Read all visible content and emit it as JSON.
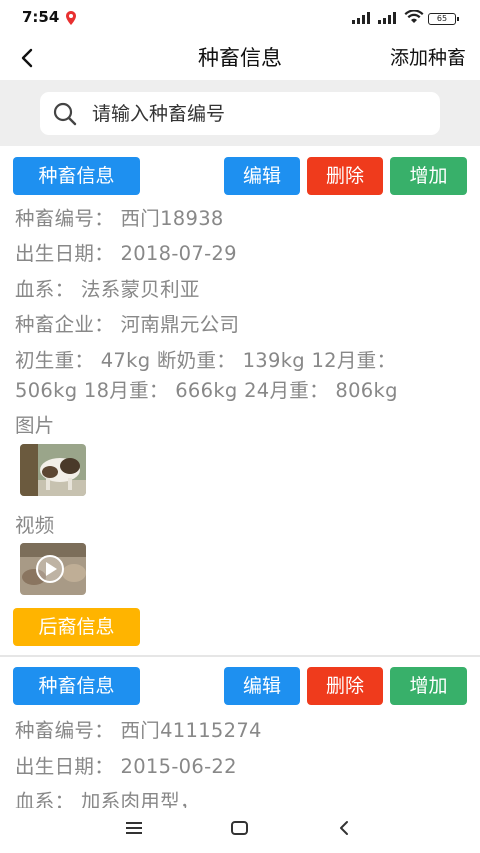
{
  "status": {
    "time": "7:54",
    "battery": "65"
  },
  "nav": {
    "title": "种畜信息",
    "action": "添加种畜"
  },
  "search": {
    "placeholder": "请输入种畜编号"
  },
  "cards": [
    {
      "info_label": "种畜信息",
      "edit_label": "编辑",
      "delete_label": "删除",
      "add_label": "增加",
      "code": "种畜编号： 西门18938",
      "birth": "出生日期： 2018-07-29",
      "lineage": "血系： 法系蒙贝利亚",
      "company": "种畜企业： 河南鼎元公司",
      "weights_line1": "初生重： 47kg 断奶重： 139kg 12月重：",
      "weights_line2": "506kg 18月重： 666kg 24月重： 806kg",
      "images_label": "图片",
      "video_label": "视频",
      "offspring_label": "后裔信息"
    },
    {
      "info_label": "种畜信息",
      "edit_label": "编辑",
      "delete_label": "删除",
      "add_label": "增加",
      "code": "种畜编号： 西门41115274",
      "birth": "出生日期： 2015-06-22",
      "lineage": "血系： 加系肉用型，"
    }
  ],
  "colors": {
    "primary": "#1e90f0",
    "danger": "#ef3b1c",
    "success": "#38b06a",
    "warning": "#ffb400"
  }
}
